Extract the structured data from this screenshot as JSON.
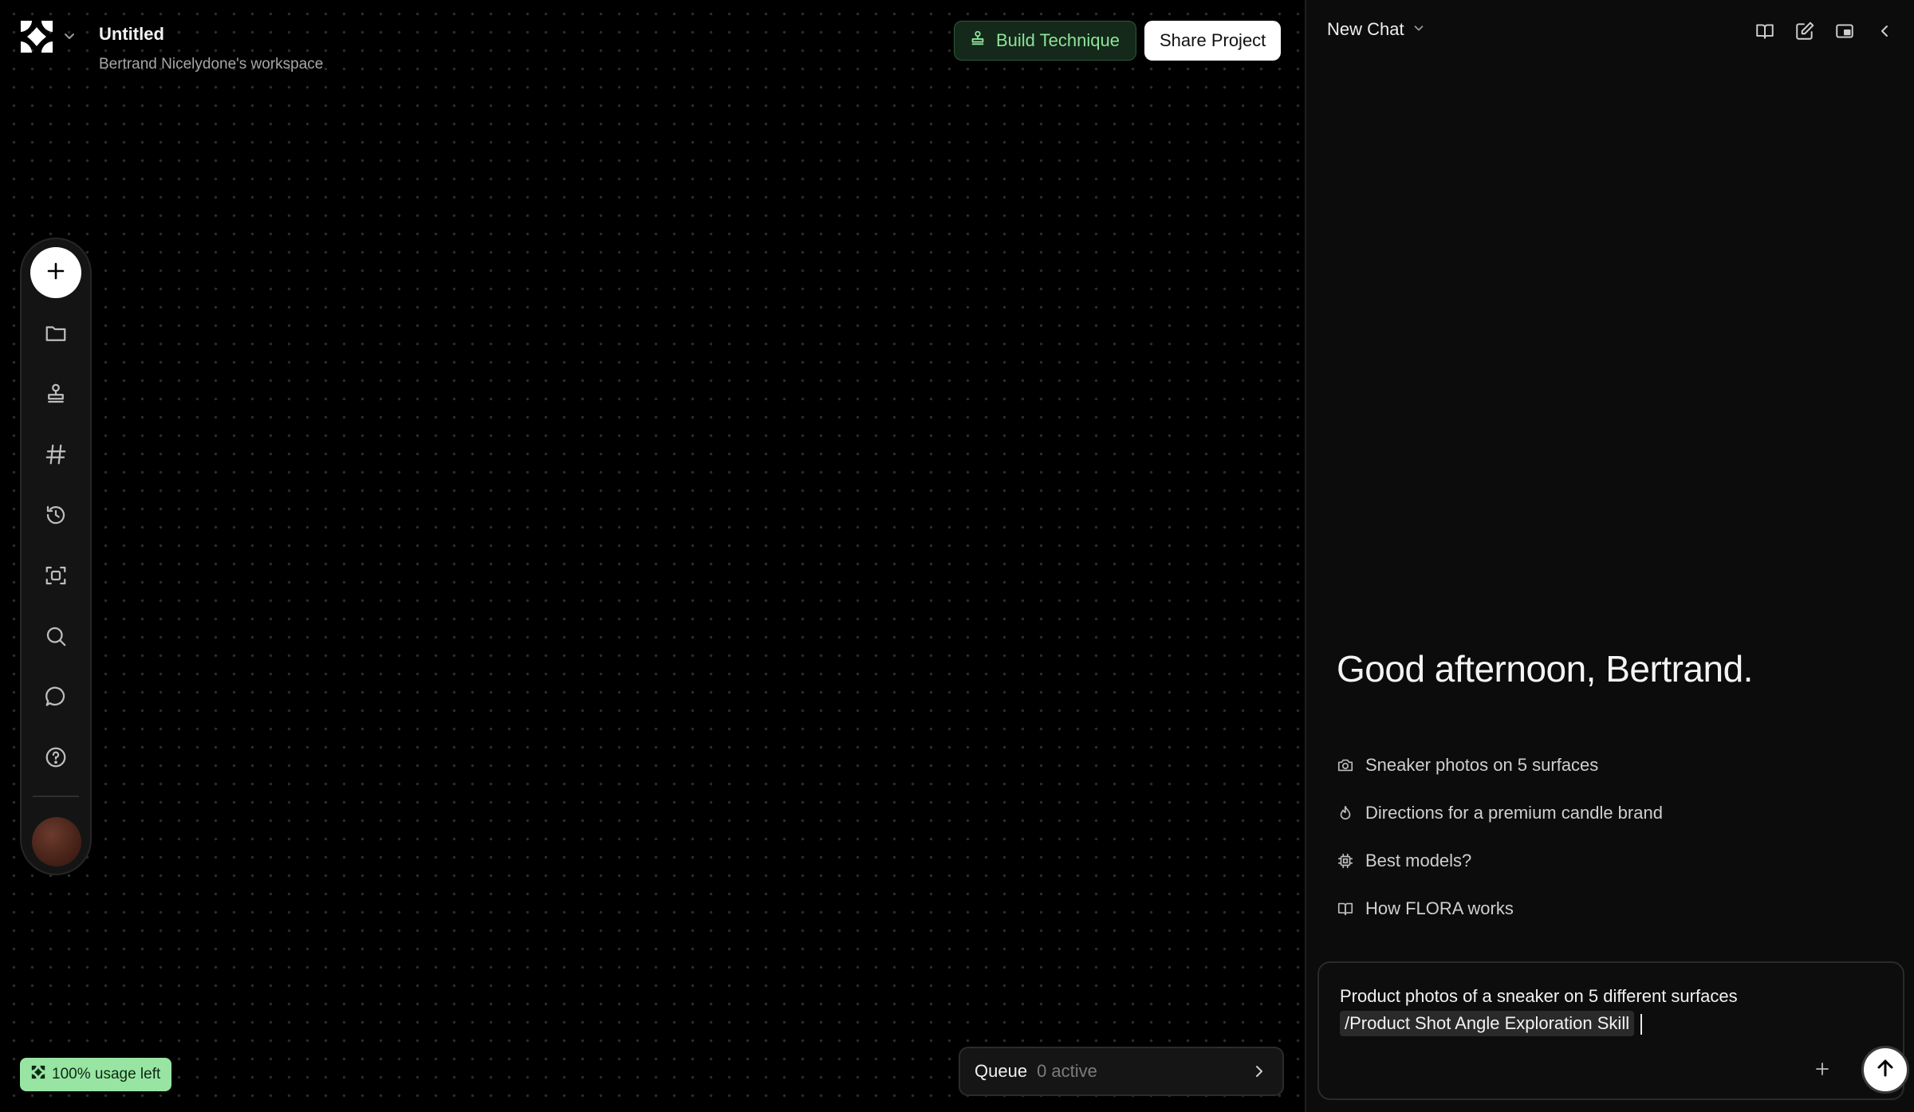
{
  "app": {
    "logo_icon": "flora-logo-icon",
    "project_title": "Untitled",
    "workspace": "Bertrand Nicelydone's workspace"
  },
  "header": {
    "build_technique_label": "Build Technique",
    "build_technique_icon": "stamp-icon",
    "share_label": "Share Project"
  },
  "toolbar": {
    "items": [
      {
        "icon": "plus-icon",
        "name": "add"
      },
      {
        "icon": "folder-icon",
        "name": "files"
      },
      {
        "icon": "stamp-icon",
        "name": "techniques"
      },
      {
        "icon": "hash-icon",
        "name": "channels"
      },
      {
        "icon": "history-icon",
        "name": "history"
      },
      {
        "icon": "scan-icon",
        "name": "scan"
      },
      {
        "icon": "search-icon",
        "name": "search"
      },
      {
        "icon": "chat-bubble-icon",
        "name": "chat"
      },
      {
        "icon": "help-icon",
        "name": "help"
      }
    ]
  },
  "usage": {
    "label": "100% usage left"
  },
  "queue": {
    "label": "Queue",
    "status": "0 active"
  },
  "chat": {
    "title": "New Chat",
    "header_icons": [
      "book-icon",
      "edit-icon",
      "picture-in-picture-icon",
      "chevron-left-icon"
    ],
    "greeting": "Good afternoon, Bertrand.",
    "suggestions": [
      {
        "icon": "camera-icon",
        "label": "Sneaker photos on 5 surfaces"
      },
      {
        "icon": "flame-icon",
        "label": "Directions for a premium candle brand"
      },
      {
        "icon": "chip-icon",
        "label": "Best models?"
      },
      {
        "icon": "book-icon",
        "label": "How FLORA works"
      }
    ],
    "composer": {
      "text": "Product photos of a sneaker on 5 different surfaces",
      "skill": "/Product Shot Angle Exploration Skill"
    }
  },
  "colors": {
    "canvas_bg": "#000000",
    "panel_bg": "#0c0c0c",
    "accent_green": "#8ee39a",
    "usage_badge_bg": "#98e5a3"
  }
}
